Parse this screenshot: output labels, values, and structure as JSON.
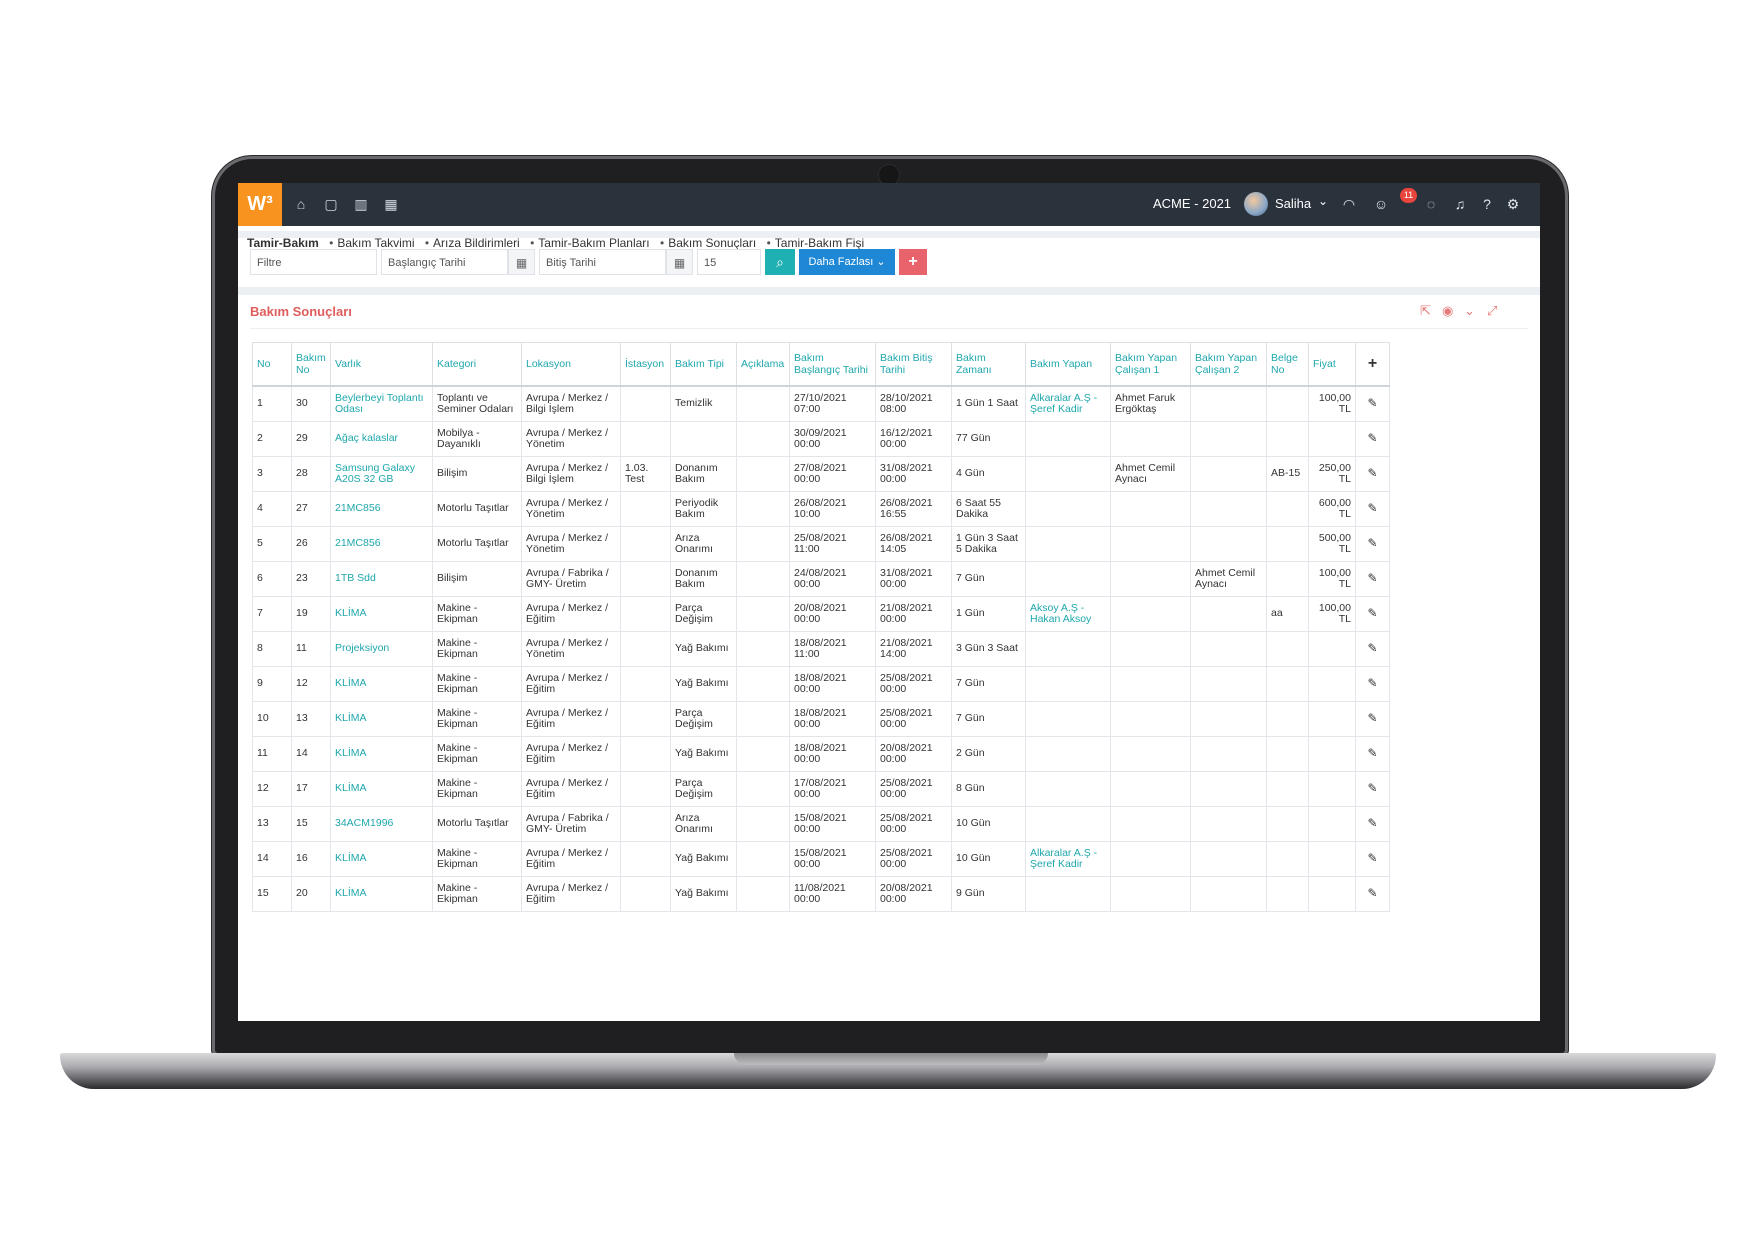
{
  "app": {
    "logo": "W³",
    "company": "ACME - 2021",
    "user": "Saliha",
    "notification_count": "11"
  },
  "breadcrumb": [
    "Tamir-Bakım",
    "Bakım Takvimi",
    "Arıza Bildirimleri",
    "Tamir-Bakım Planları",
    "Bakım Sonuçları",
    "Tamir-Bakım Fişi"
  ],
  "filters": {
    "filter_placeholder": "Filtre",
    "start_placeholder": "Başlangıç Tarihi",
    "end_placeholder": "Bitiş Tarihi",
    "page_size": "15",
    "more_label": "Daha Fazlası",
    "add_label": "+"
  },
  "panel": {
    "title": "Bakım Sonuçları"
  },
  "table": {
    "headers": [
      "No",
      "Bakım No",
      "Varlık",
      "Kategori",
      "Lokasyon",
      "İstasyon",
      "Bakım Tipi",
      "Açıklama",
      "Bakım Başlangıç Tarihi",
      "Bakım Bitiş Tarihi",
      "Bakım Zamanı",
      "Bakım Yapan",
      "Bakım Yapan Çalışan 1",
      "Bakım Yapan Çalışan 2",
      "Belge No",
      "Fiyat",
      "+"
    ],
    "rows": [
      [
        "1",
        "30",
        "Beylerbeyi Toplantı Odası",
        "Toplantı ve Seminer Odaları",
        "Avrupa / Merkez / Bilgi İşlem",
        "",
        "Temizlik",
        "",
        "27/10/2021 07:00",
        "28/10/2021 08:00",
        "1 Gün 1 Saat",
        "Alkaralar A.Ş - Şeref Kadir",
        "Ahmet Faruk Ergöktaş",
        "",
        "",
        "100,00 TL"
      ],
      [
        "2",
        "29",
        "Ağaç kalaslar",
        "Mobilya - Dayanıklı",
        "Avrupa / Merkez / Yönetim",
        "",
        "",
        "",
        "30/09/2021 00:00",
        "16/12/2021 00:00",
        "77 Gün",
        "",
        "",
        "",
        "",
        ""
      ],
      [
        "3",
        "28",
        "Samsung Galaxy A20S 32 GB",
        "Bilişim",
        "Avrupa / Merkez / Bilgi İşlem",
        "1.03. Test",
        "Donanım Bakım",
        "",
        "27/08/2021 00:00",
        "31/08/2021 00:00",
        "4 Gün",
        "",
        "Ahmet Cemil Aynacı",
        "",
        "AB-15",
        "250,00 TL"
      ],
      [
        "4",
        "27",
        "21MC856",
        "Motorlu Taşıtlar",
        "Avrupa / Merkez / Yönetim",
        "",
        "Periyodik Bakım",
        "",
        "26/08/2021 10:00",
        "26/08/2021 16:55",
        "6 Saat 55 Dakika",
        "",
        "",
        "",
        "",
        "600,00 TL"
      ],
      [
        "5",
        "26",
        "21MC856",
        "Motorlu Taşıtlar",
        "Avrupa / Merkez / Yönetim",
        "",
        "Arıza Onarımı",
        "",
        "25/08/2021 11:00",
        "26/08/2021 14:05",
        "1 Gün 3 Saat 5 Dakika",
        "",
        "",
        "",
        "",
        "500,00 TL"
      ],
      [
        "6",
        "23",
        "1TB Sdd",
        "Bilişim",
        "Avrupa / Fabrika / GMY- Üretim",
        "",
        "Donanım Bakım",
        "",
        "24/08/2021 00:00",
        "31/08/2021 00:00",
        "7 Gün",
        "",
        "",
        "Ahmet Cemil Aynacı",
        "",
        "100,00 TL"
      ],
      [
        "7",
        "19",
        "KLİMA",
        "Makine - Ekipman",
        "Avrupa / Merkez / Eğitim",
        "",
        "Parça Değişim",
        "",
        "20/08/2021 00:00",
        "21/08/2021 00:00",
        "1 Gün",
        "Aksoy A.Ş - Hakan Aksoy",
        "",
        "",
        "aa",
        "100,00 TL"
      ],
      [
        "8",
        "11",
        "Projeksiyon",
        "Makine - Ekipman",
        "Avrupa / Merkez / Yönetim",
        "",
        "Yağ Bakımı",
        "",
        "18/08/2021 11:00",
        "21/08/2021 14:00",
        "3 Gün 3 Saat",
        "",
        "",
        "",
        "",
        ""
      ],
      [
        "9",
        "12",
        "KLİMA",
        "Makine - Ekipman",
        "Avrupa / Merkez / Eğitim",
        "",
        "Yağ Bakımı",
        "",
        "18/08/2021 00:00",
        "25/08/2021 00:00",
        "7 Gün",
        "",
        "",
        "",
        "",
        ""
      ],
      [
        "10",
        "13",
        "KLİMA",
        "Makine - Ekipman",
        "Avrupa / Merkez / Eğitim",
        "",
        "Parça Değişim",
        "",
        "18/08/2021 00:00",
        "25/08/2021 00:00",
        "7 Gün",
        "",
        "",
        "",
        "",
        ""
      ],
      [
        "11",
        "14",
        "KLİMA",
        "Makine - Ekipman",
        "Avrupa / Merkez / Eğitim",
        "",
        "Yağ Bakımı",
        "",
        "18/08/2021 00:00",
        "20/08/2021 00:00",
        "2 Gün",
        "",
        "",
        "",
        "",
        ""
      ],
      [
        "12",
        "17",
        "KLİMA",
        "Makine - Ekipman",
        "Avrupa / Merkez / Eğitim",
        "",
        "Parça Değişim",
        "",
        "17/08/2021 00:00",
        "25/08/2021 00:00",
        "8 Gün",
        "",
        "",
        "",
        "",
        ""
      ],
      [
        "13",
        "15",
        "34ACM1996",
        "Motorlu Taşıtlar",
        "Avrupa / Fabrika / GMY- Üretim",
        "",
        "Arıza Onarımı",
        "",
        "15/08/2021 00:00",
        "25/08/2021 00:00",
        "10 Gün",
        "",
        "",
        "",
        "",
        ""
      ],
      [
        "14",
        "16",
        "KLİMA",
        "Makine - Ekipman",
        "Avrupa / Merkez / Eğitim",
        "",
        "Yağ Bakımı",
        "",
        "15/08/2021 00:00",
        "25/08/2021 00:00",
        "10 Gün",
        "Alkaralar A.Ş - Şeref Kadir",
        "",
        "",
        "",
        ""
      ],
      [
        "15",
        "20",
        "KLİMA",
        "Makine - Ekipman",
        "Avrupa / Merkez / Eğitim",
        "",
        "Yağ Bakımı",
        "",
        "11/08/2021 00:00",
        "20/08/2021 00:00",
        "9 Gün",
        "",
        "",
        "",
        "",
        ""
      ]
    ]
  },
  "colors": {
    "accent": "#1fa7ad",
    "topbar": "#2a323c",
    "logo": "#f7931e",
    "panel_title": "#e05d5d"
  }
}
